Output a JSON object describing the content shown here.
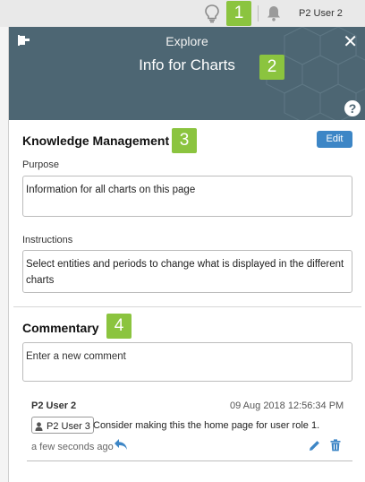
{
  "topbar": {
    "user_name": "P2 User 2"
  },
  "markers": [
    "1",
    "2",
    "3",
    "4"
  ],
  "header": {
    "explore": "Explore",
    "title": "Info for Charts",
    "close_glyph": "✕",
    "help_glyph": "?"
  },
  "knowledge": {
    "title": "Knowledge Management",
    "edit_label": "Edit",
    "purpose_label": "Purpose",
    "purpose_value": "Information for all charts on this page",
    "instructions_label": "Instructions",
    "instructions_value": "Select entities and periods to change what is displayed in the different charts"
  },
  "commentary": {
    "title": "Commentary",
    "placeholder": "Enter a new comment",
    "comments": [
      {
        "author": "P2 User 2",
        "date": "09 Aug 2018 12:56:34 PM",
        "mention": "P2 User 3",
        "text": "Consider making this the home page for user role 1.",
        "relative_time": "a few seconds ago"
      }
    ]
  },
  "icons": [
    "lightbulb-icon",
    "bell-icon",
    "pin-icon",
    "close-icon",
    "help-icon",
    "user-icon",
    "reply-icon",
    "pencil-icon",
    "trash-icon"
  ],
  "colors": {
    "header_bg": "#4d6673",
    "accent": "#3d86c6",
    "marker": "#8bc43f"
  }
}
